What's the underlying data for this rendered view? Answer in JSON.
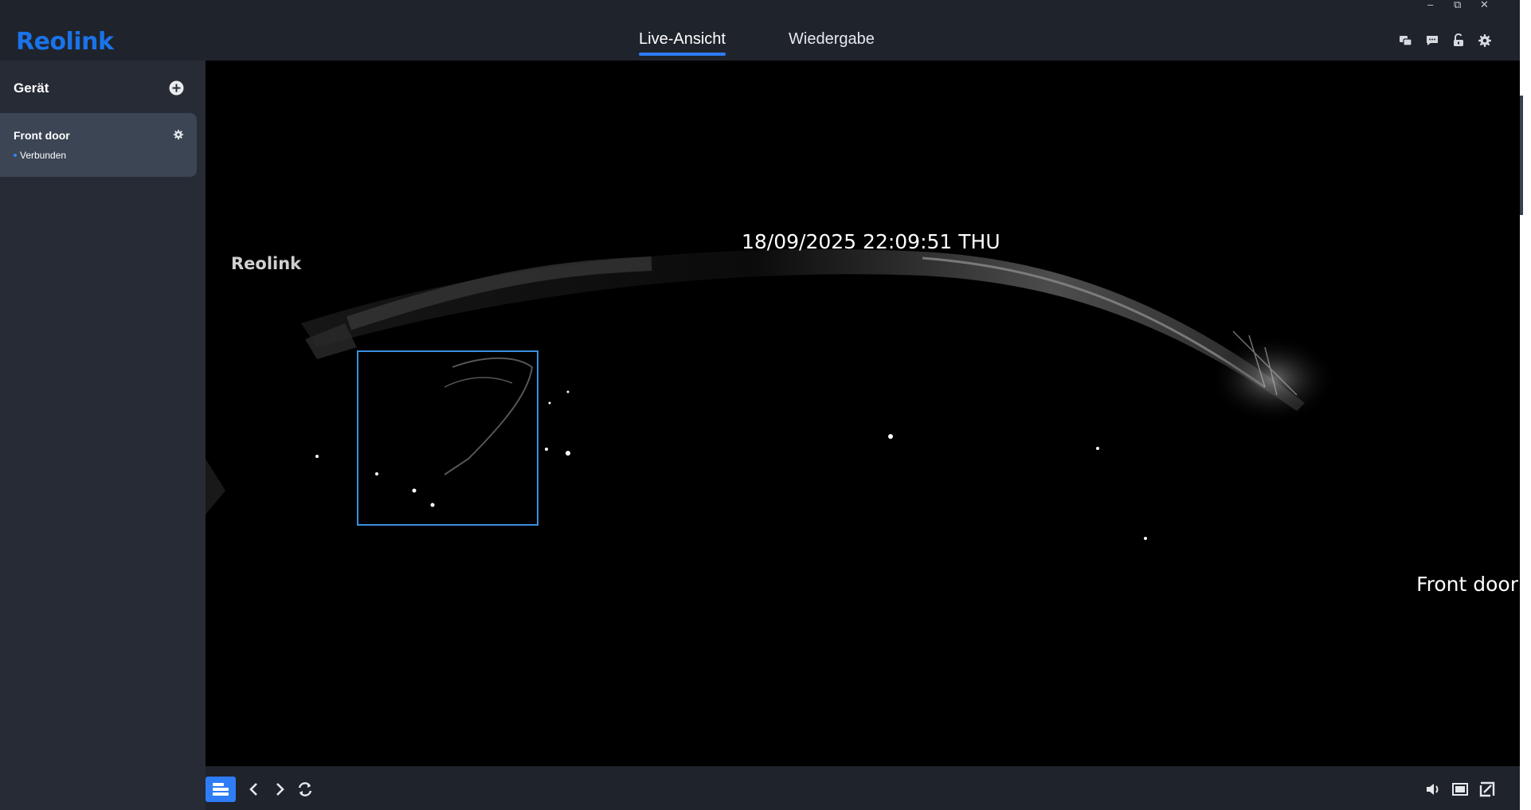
{
  "app": {
    "logo_text": "Reolink"
  },
  "nav": {
    "tabs": [
      {
        "label": "Live-Ansicht",
        "active": true
      },
      {
        "label": "Wiedergabe",
        "active": false
      }
    ]
  },
  "window_controls": {
    "minimize": "–",
    "restore": "⧉",
    "close": "✕"
  },
  "top_icons": [
    "chat-bubbles-icon",
    "message-icon",
    "unlock-icon",
    "gear-icon"
  ],
  "sidebar": {
    "title": "Gerät",
    "devices": [
      {
        "name": "Front door",
        "status": "Verbunden"
      }
    ]
  },
  "video": {
    "osd_timestamp": "18/09/2025 22:09:51 THU",
    "osd_logo": "Reolink",
    "osd_camera_name": "Front door"
  },
  "bottom_toolbar": {
    "left_icons": [
      "layout-icon",
      "chevron-left-icon",
      "chevron-right-icon",
      "refresh-icon"
    ],
    "right_icons": [
      "volume-icon",
      "screen-ratio-icon",
      "fullscreen-icon"
    ]
  },
  "colors": {
    "accent": "#2e7cf6",
    "background": "#1f232c",
    "sidebar": "#262b35",
    "selected_card": "#3b4554",
    "video": "#000000",
    "detection_box": "#3b8fe0"
  }
}
